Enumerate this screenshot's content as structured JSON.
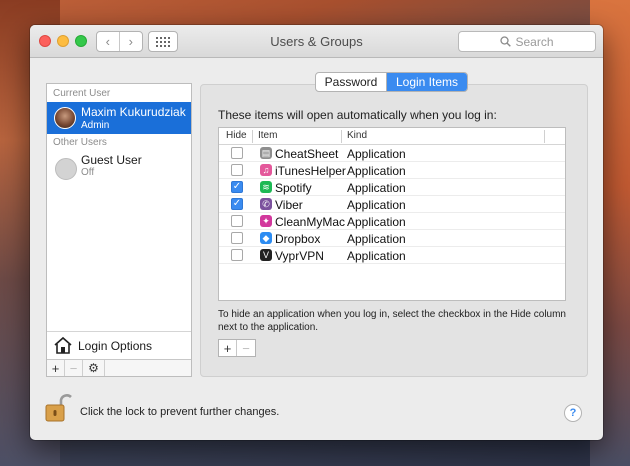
{
  "window": {
    "title": "Users & Groups"
  },
  "toolbar": {
    "search_placeholder": "Search"
  },
  "sidebar": {
    "current_user_label": "Current User",
    "current_user": {
      "name": "Maxim Kukurudziak",
      "role": "Admin"
    },
    "other_users_label": "Other Users",
    "other_users": [
      {
        "name": "Guest User",
        "status": "Off"
      }
    ],
    "login_options_label": "Login Options",
    "buttons": {
      "add": "+",
      "remove": "−",
      "gear": "⚙"
    }
  },
  "tabs": {
    "password": "Password",
    "login_items": "Login Items",
    "active": "Login Items"
  },
  "login_items": {
    "heading": "These items will open automatically when you log in:",
    "columns": {
      "hide": "Hide",
      "item": "Item",
      "kind": "Kind"
    },
    "rows": [
      {
        "name": "CheatSheet",
        "kind": "Application",
        "hide": false,
        "icon": "cheatsheet-icon",
        "color": "#8e8e8e"
      },
      {
        "name": "iTunesHelper",
        "kind": "Application",
        "hide": false,
        "icon": "itunes-icon",
        "color": "#e4589b"
      },
      {
        "name": "Spotify",
        "kind": "Application",
        "hide": true,
        "icon": "spotify-icon",
        "color": "#1db954"
      },
      {
        "name": "Viber",
        "kind": "Application",
        "hide": true,
        "icon": "viber-icon",
        "color": "#7b519d"
      },
      {
        "name": "CleanMyMac",
        "kind": "Application",
        "hide": false,
        "icon": "cleanmymac-icon",
        "color": "#d2389c"
      },
      {
        "name": "Dropbox",
        "kind": "Application",
        "hide": false,
        "icon": "dropbox-icon",
        "color": "#2c8cf2"
      },
      {
        "name": "VyprVPN",
        "kind": "Application",
        "hide": false,
        "icon": "vyprvpn-icon",
        "color": "#222222"
      }
    ],
    "hint": "To hide an application when you log in, select the checkbox in the Hide column next to the application.",
    "add_label": "+",
    "remove_label": "−"
  },
  "footer": {
    "lock_text": "Click the lock to prevent further changes.",
    "help": "?"
  },
  "colors": {
    "accent": "#3a8bf0",
    "selection": "#1a6fd9"
  }
}
